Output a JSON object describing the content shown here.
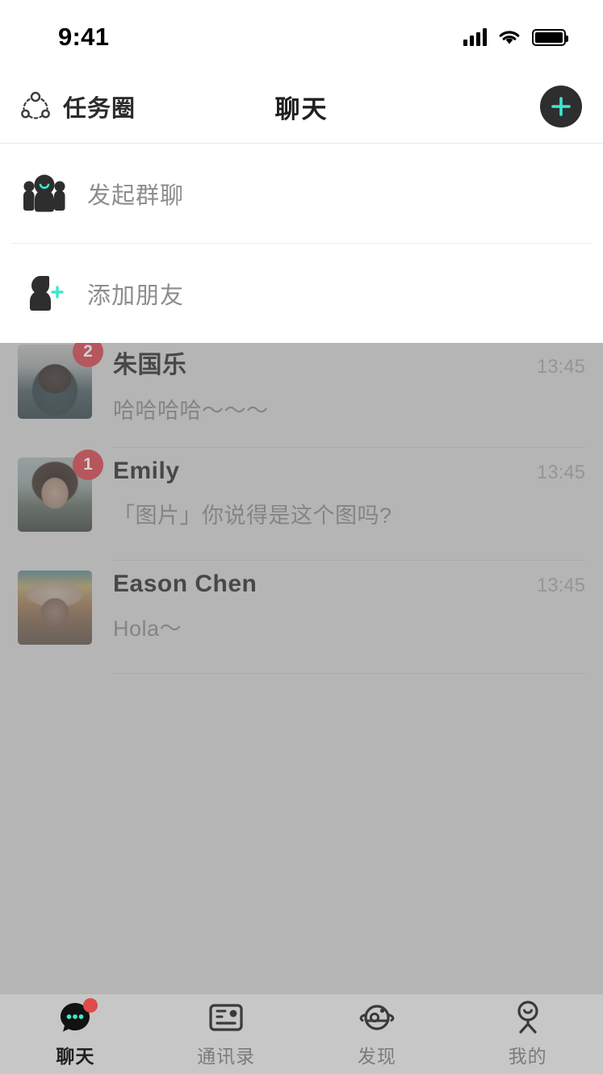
{
  "status_bar": {
    "time": "9:41",
    "signal_icon": "signal-bars-icon",
    "wifi_icon": "wifi-icon",
    "battery_icon": "battery-full-icon"
  },
  "nav_bar": {
    "left_label": "任务圈",
    "left_icon": "task-circle-icon",
    "title": "聊天",
    "add_icon": "plus-icon",
    "accent_color": "#3ee8d0",
    "button_bg": "#2e2e2e"
  },
  "dropdown": {
    "items": [
      {
        "label": "发起群聊",
        "icon": "group-chat-icon"
      },
      {
        "label": "添加朋友",
        "icon": "add-friend-icon"
      }
    ]
  },
  "chat_list": {
    "rows": [
      {
        "name": "朱国乐",
        "message": "哈哈哈哈～～～",
        "time": "13:45",
        "badge": "2",
        "avatar": "hooded-man-avatar"
      },
      {
        "name": "Emily",
        "message": "「图片」你说得是这个图吗?",
        "time": "13:45",
        "badge": "1",
        "avatar": "smiling-woman-avatar"
      },
      {
        "name": "Eason Chen",
        "message": "Hola～",
        "time": "13:45",
        "badge": "",
        "avatar": "hat-person-avatar"
      }
    ]
  },
  "tab_bar": {
    "tabs": [
      {
        "label": "聊天",
        "icon": "chat-bubble-icon",
        "active": true,
        "badge_dot": true
      },
      {
        "label": "通讯录",
        "icon": "contact-card-icon",
        "active": false,
        "badge_dot": false
      },
      {
        "label": "发现",
        "icon": "discover-planet-icon",
        "active": false,
        "badge_dot": false
      },
      {
        "label": "我的",
        "icon": "profile-person-icon",
        "active": false,
        "badge_dot": false
      }
    ],
    "badge_color": "#e04b4b"
  }
}
